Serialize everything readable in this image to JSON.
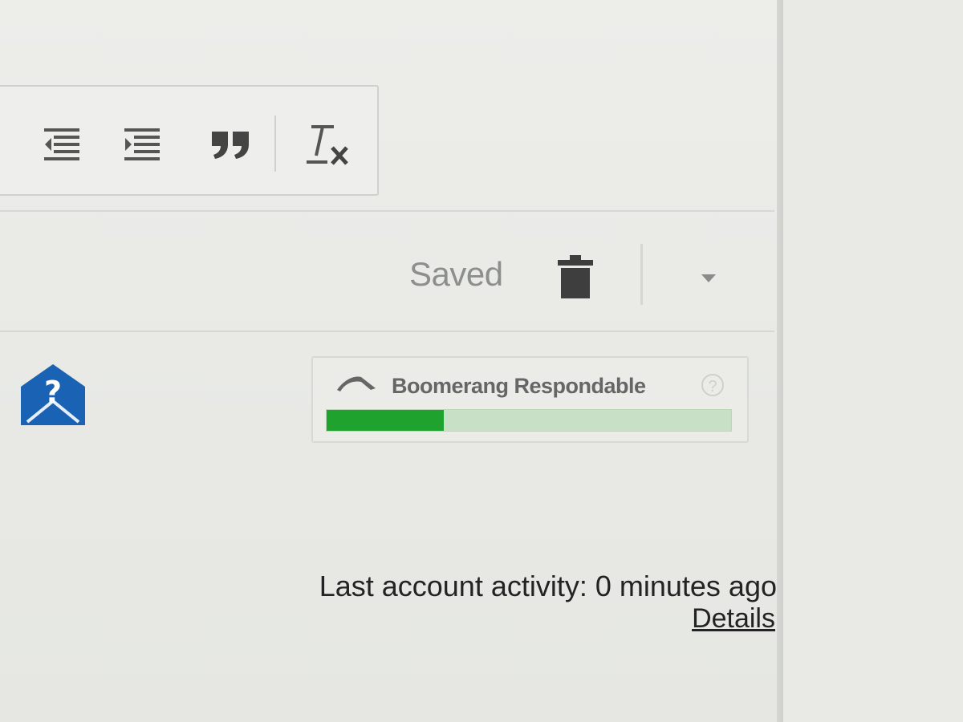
{
  "toolbar": {
    "buttons": [
      {
        "name": "indent-less-icon"
      },
      {
        "name": "indent-more-icon"
      },
      {
        "name": "quote-icon"
      },
      {
        "name": "remove-formatting-icon"
      }
    ]
  },
  "actions": {
    "saved_label": "Saved",
    "trash_icon": "trash-icon",
    "more_icon": "chevron-down-icon"
  },
  "help": {
    "icon": "help-mail-icon",
    "color": "#1a62b4"
  },
  "boomerang": {
    "title": "Boomerang Respondable",
    "help_glyph": "?",
    "meter_fraction": 0.29,
    "meter_color": "#1fa32e"
  },
  "footer": {
    "activity": "Last account activity: 0 minutes ago",
    "details": "Details"
  }
}
